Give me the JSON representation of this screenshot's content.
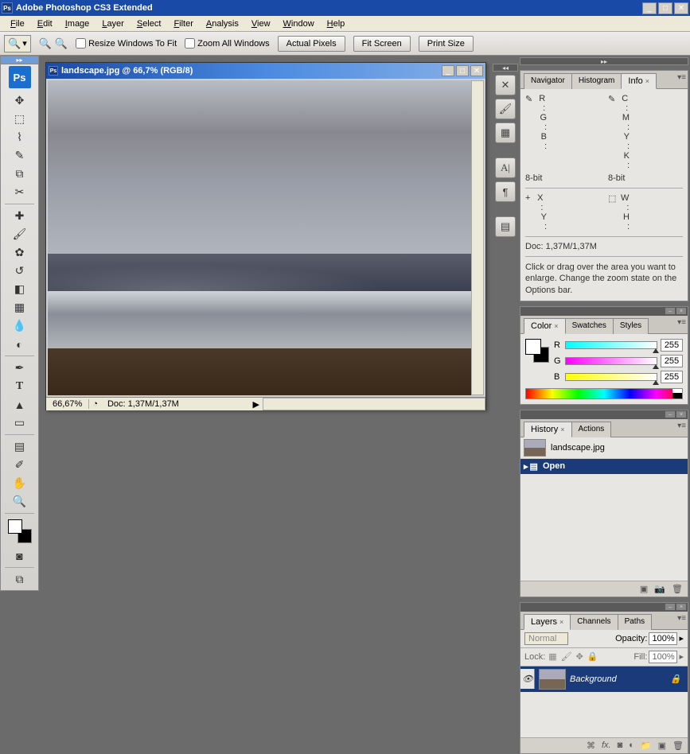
{
  "app": {
    "title": "Adobe Photoshop CS3 Extended",
    "logo": "Ps"
  },
  "menu": [
    "File",
    "Edit",
    "Image",
    "Layer",
    "Select",
    "Filter",
    "Analysis",
    "View",
    "Window",
    "Help"
  ],
  "options": {
    "resize_label": "Resize Windows To Fit",
    "zoom_all_label": "Zoom All Windows",
    "actual_pixels": "Actual Pixels",
    "fit_screen": "Fit Screen",
    "print_size": "Print Size"
  },
  "document": {
    "title": "landscape.jpg @ 66,7% (RGB/8)",
    "zoom": "66,67%",
    "doc_info": "Doc: 1,37M/1,37M"
  },
  "info_panel": {
    "tabs": [
      "Navigator",
      "Histogram",
      "Info"
    ],
    "rgb": {
      "r": "R :",
      "g": "G :",
      "b": "B :"
    },
    "cmyk": {
      "c": "C :",
      "m": "M :",
      "y": "Y :",
      "k": "K :"
    },
    "depth": "8-bit",
    "xy": {
      "x": "X :",
      "y": "Y :"
    },
    "wh": {
      "w": "W :",
      "h": "H :"
    },
    "doc": "Doc: 1,37M/1,37M",
    "hint": "Click or drag over the area you want to enlarge. Change the zoom state on the Options bar."
  },
  "color_panel": {
    "tabs": [
      "Color",
      "Swatches",
      "Styles"
    ],
    "r_label": "R",
    "g_label": "G",
    "b_label": "B",
    "r_val": "255",
    "g_val": "255",
    "b_val": "255"
  },
  "history_panel": {
    "tabs": [
      "History",
      "Actions"
    ],
    "filename": "landscape.jpg",
    "open_step": "Open"
  },
  "layers_panel": {
    "tabs": [
      "Layers",
      "Channels",
      "Paths"
    ],
    "blend_mode": "Normal",
    "opacity_label": "Opacity:",
    "opacity": "100%",
    "lock_label": "Lock:",
    "fill_label": "Fill:",
    "fill": "100%",
    "layer_name": "Background"
  }
}
